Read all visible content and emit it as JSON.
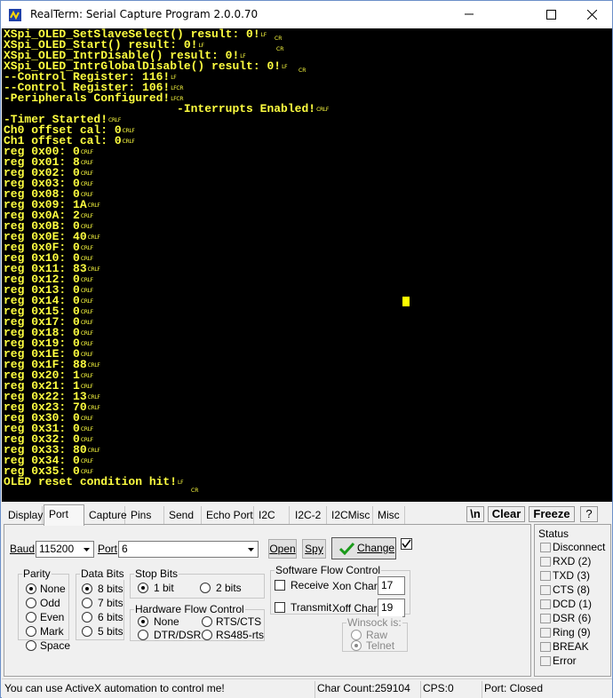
{
  "window": {
    "title": "RealTerm: Serial Capture Program 2.0.0.70"
  },
  "terminal": {
    "lines": [
      {
        "t": "XSpi_OLED_SetSlaveSelect() result: 0!",
        "s": "LF",
        "e": "CR",
        "ex": 305
      },
      {
        "t": "XSpi_OLED_Start() result: 0!",
        "s": "LF",
        "e": "CR",
        "ex": 307
      },
      {
        "t": "XSpi_OLED_IntrDisable() result: 0!",
        "s": "LF"
      },
      {
        "t": "XSpi_OLED_IntrGlobalDisable() result: 0!",
        "s": "LF",
        "e": "CR",
        "ex": 332
      },
      {
        "t": "--Control Register: 116!",
        "s": "LF"
      },
      {
        "t": "--Control Register: 106!",
        "s": "LFCR"
      },
      {
        "t": "-Peripherals Configured!",
        "s": "LFCR"
      },
      {
        "t": "                         -Interrupts Enabled!",
        "s": "CRLF"
      },
      {
        "t": "-Timer Started!",
        "s": "CRLF"
      },
      {
        "t": "Ch0 offset cal: 0",
        "s": "CRLF"
      },
      {
        "t": "Ch1 offset cal: 0",
        "s": "CRLF"
      },
      {
        "t": "reg 0x00: 0",
        "s": "CRLF"
      },
      {
        "t": "reg 0x01: 8",
        "s": "CRLF"
      },
      {
        "t": "reg 0x02: 0",
        "s": "CRLF"
      },
      {
        "t": "reg 0x03: 0",
        "s": "CRLF"
      },
      {
        "t": "reg 0x08: 0",
        "s": "CRLF"
      },
      {
        "t": "reg 0x09: 1A",
        "s": "CRLF"
      },
      {
        "t": "reg 0x0A: 2",
        "s": "CRLF"
      },
      {
        "t": "reg 0x0B: 0",
        "s": "CRLF"
      },
      {
        "t": "reg 0x0E: 40",
        "s": "CRLF"
      },
      {
        "t": "reg 0x0F: 0",
        "s": "CRLF"
      },
      {
        "t": "reg 0x10: 0",
        "s": "CRLF"
      },
      {
        "t": "reg 0x11: 83",
        "s": "CRLF"
      },
      {
        "t": "reg 0x12: 0",
        "s": "CRLF"
      },
      {
        "t": "reg 0x13: 0",
        "s": "CRLF"
      },
      {
        "t": "reg 0x14: 0",
        "s": "CRLF"
      },
      {
        "t": "reg 0x15: 0",
        "s": "CRLF"
      },
      {
        "t": "reg 0x17: 0",
        "s": "CRLF"
      },
      {
        "t": "reg 0x18: 0",
        "s": "CRLF"
      },
      {
        "t": "reg 0x19: 0",
        "s": "CRLF"
      },
      {
        "t": "reg 0x1E: 0",
        "s": "CRLF"
      },
      {
        "t": "reg 0x1F: 88",
        "s": "CRLF"
      },
      {
        "t": "reg 0x20: 1",
        "s": "CRLF"
      },
      {
        "t": "reg 0x21: 1",
        "s": "CRLF"
      },
      {
        "t": "reg 0x22: 13",
        "s": "CRLF"
      },
      {
        "t": "reg 0x23: 70",
        "s": "CRLF"
      },
      {
        "t": "reg 0x30: 0",
        "s": "CRLF"
      },
      {
        "t": "reg 0x31: 0",
        "s": "CRLF"
      },
      {
        "t": "reg 0x32: 0",
        "s": "CRLF"
      },
      {
        "t": "reg 0x33: 80",
        "s": "CRLF"
      },
      {
        "t": "reg 0x34: 0",
        "s": "CRLF"
      },
      {
        "t": "reg 0x35: 0",
        "s": "CRLF"
      },
      {
        "t": "OLED reset condition hit!",
        "s": "LF"
      },
      {
        "t": "",
        "e": "CR",
        "ex": 211
      }
    ]
  },
  "tabs": [
    "Display",
    "Port",
    "Capture",
    "Pins",
    "Send",
    "Echo Port",
    "I2C",
    "I2C-2",
    "I2CMisc",
    "Misc"
  ],
  "active_tab": "Port",
  "toolbar": {
    "newline_btn": "\\n",
    "clear_btn": "Clear",
    "freeze_btn": "Freeze",
    "help_btn": "?"
  },
  "port": {
    "baud_label": "Baud",
    "baud_value": "115200",
    "port_label": "Port",
    "port_value": "6",
    "open_btn": "Open",
    "spy_btn": "Spy",
    "change_btn": "Change",
    "parity": {
      "title": "Parity",
      "options": [
        "None",
        "Odd",
        "Even",
        "Mark",
        "Space"
      ],
      "selected": 0
    },
    "data_bits": {
      "title": "Data Bits",
      "options": [
        "8 bits",
        "7 bits",
        "6 bits",
        "5 bits"
      ],
      "selected": 0
    },
    "stop_bits": {
      "title": "Stop Bits",
      "options": [
        "1 bit",
        "2 bits"
      ],
      "selected": 0
    },
    "hw_flow": {
      "title": "Hardware Flow Control",
      "options": [
        "None",
        "RTS/CTS",
        "DTR/DSR",
        "RS485-rts"
      ],
      "selected": 0
    },
    "sw_flow": {
      "title": "Software Flow Control",
      "receive": "Receive",
      "transmit": "Transmit",
      "xon_label": "Xon Char:",
      "xon_value": "17",
      "xoff_label": "Xoff Char:",
      "xoff_value": "19"
    },
    "winsock": {
      "title": "Winsock is:",
      "options": [
        "Raw",
        "Telnet"
      ],
      "selected": 1
    }
  },
  "status": {
    "title": "Status",
    "items": [
      "Disconnect",
      "RXD (2)",
      "TXD (3)",
      "CTS (8)",
      "DCD (1)",
      "DSR (6)",
      "Ring (9)",
      "BREAK",
      "Error"
    ]
  },
  "statusbar": {
    "message": "You can use ActiveX automation to control me!",
    "char_count": "Char Count:259104",
    "cps": "CPS:0",
    "port_state": "Port: Closed"
  },
  "colors": {
    "terminal_bg": "#000000",
    "terminal_fg": "#ffff40",
    "change_check": "#1a9a1a"
  }
}
